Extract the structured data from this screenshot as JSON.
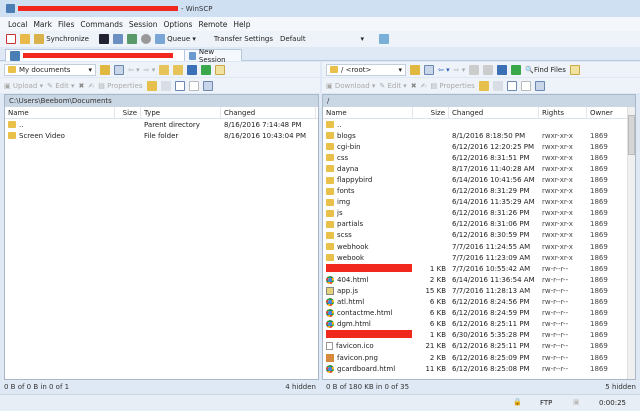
{
  "window": {
    "title_suffix": "- WinSCP"
  },
  "menu": [
    "Local",
    "Mark",
    "Files",
    "Commands",
    "Session",
    "Options",
    "Remote",
    "Help"
  ],
  "toolbar": {
    "synchronize": "Synchronize",
    "queue": "Queue",
    "queue_arrow": "▾",
    "transfer_settings_label": "Transfer Settings",
    "transfer_settings_value": "Default"
  },
  "tabs": {
    "new_session": "New Session"
  },
  "left": {
    "location": "My documents",
    "upload": "Upload",
    "edit": "Edit",
    "properties": "Properties",
    "path": "C:\\Users\\Beebom\\Documents",
    "columns": [
      "Name",
      "Size",
      "Type",
      "Changed"
    ],
    "rows": [
      {
        "name": "..",
        "size": "",
        "type": "Parent directory",
        "changed": "8/16/2016  7:14:48 PM",
        "icon": "parent"
      },
      {
        "name": "Screen Video",
        "size": "",
        "type": "File folder",
        "changed": "8/16/2016  10:43:04 PM",
        "icon": "folder"
      }
    ],
    "status_left": "0 B of 0 B in 0 of 1",
    "status_right": "4 hidden"
  },
  "right": {
    "location": "/ <root>",
    "find_files": "Find Files",
    "download": "Download",
    "edit": "Edit",
    "properties": "Properties",
    "path": "/",
    "columns": [
      "Name",
      "Size",
      "Changed",
      "Rights",
      "Owner"
    ],
    "rows": [
      {
        "name": "..",
        "size": "",
        "changed": "",
        "rights": "",
        "owner": "",
        "icon": "parent"
      },
      {
        "name": "blogs",
        "size": "",
        "changed": "8/1/2016 8:18:50 PM",
        "rights": "rwxr-xr-x",
        "owner": "1869",
        "icon": "folder"
      },
      {
        "name": "cgi-bin",
        "size": "",
        "changed": "6/12/2016 12:20:25 PM",
        "rights": "rwxr-xr-x",
        "owner": "1869",
        "icon": "folder"
      },
      {
        "name": "css",
        "size": "",
        "changed": "6/12/2016 8:31:51 PM",
        "rights": "rwxr-xr-x",
        "owner": "1869",
        "icon": "folder"
      },
      {
        "name": "dayna",
        "size": "",
        "changed": "8/17/2016 11:40:28 AM",
        "rights": "rwxr-xr-x",
        "owner": "1869",
        "icon": "folder"
      },
      {
        "name": "flappybird",
        "size": "",
        "changed": "6/14/2016 10:41:56 AM",
        "rights": "rwxr-xr-x",
        "owner": "1869",
        "icon": "folder"
      },
      {
        "name": "fonts",
        "size": "",
        "changed": "6/12/2016 8:31:29 PM",
        "rights": "rwxr-xr-x",
        "owner": "1869",
        "icon": "folder"
      },
      {
        "name": "img",
        "size": "",
        "changed": "6/14/2016 11:35:29 AM",
        "rights": "rwxr-xr-x",
        "owner": "1869",
        "icon": "folder"
      },
      {
        "name": "js",
        "size": "",
        "changed": "6/12/2016 8:31:26 PM",
        "rights": "rwxr-xr-x",
        "owner": "1869",
        "icon": "folder"
      },
      {
        "name": "partials",
        "size": "",
        "changed": "6/12/2016 8:31:06 PM",
        "rights": "rwxr-xr-x",
        "owner": "1869",
        "icon": "folder"
      },
      {
        "name": "scss",
        "size": "",
        "changed": "6/12/2016 8:30:59 PM",
        "rights": "rwxr-xr-x",
        "owner": "1869",
        "icon": "folder"
      },
      {
        "name": "webhook",
        "size": "",
        "changed": "7/7/2016 11:24:55 AM",
        "rights": "rwxr-xr-x",
        "owner": "1869",
        "icon": "folder"
      },
      {
        "name": "webook",
        "size": "",
        "changed": "7/7/2016 11:23:09 AM",
        "rights": "rwxr-xr-x",
        "owner": "1869",
        "icon": "folder"
      },
      {
        "name": "",
        "size": "1 KB",
        "changed": "7/7/2016 10:55:42 AM",
        "rights": "rw-r--r--",
        "owner": "1869",
        "icon": "redacted"
      },
      {
        "name": "404.html",
        "size": "2 KB",
        "changed": "6/14/2016 11:36:54 AM",
        "rights": "rw-r--r--",
        "owner": "1869",
        "icon": "chrome"
      },
      {
        "name": "app.js",
        "size": "15 KB",
        "changed": "7/7/2016 11:28:13 AM",
        "rights": "rw-r--r--",
        "owner": "1869",
        "icon": "js"
      },
      {
        "name": "atl.html",
        "size": "6 KB",
        "changed": "6/12/2016 8:24:56 PM",
        "rights": "rw-r--r--",
        "owner": "1869",
        "icon": "chrome"
      },
      {
        "name": "contactme.html",
        "size": "6 KB",
        "changed": "6/12/2016 8:24:59 PM",
        "rights": "rw-r--r--",
        "owner": "1869",
        "icon": "chrome"
      },
      {
        "name": "dgm.html",
        "size": "6 KB",
        "changed": "6/12/2016 8:25:11 PM",
        "rights": "rw-r--r--",
        "owner": "1869",
        "icon": "chrome"
      },
      {
        "name": "",
        "size": "1 KB",
        "changed": "6/30/2016 5:35:28 PM",
        "rights": "rw-r--r--",
        "owner": "1869",
        "icon": "redacted"
      },
      {
        "name": "favicon.ico",
        "size": "21 KB",
        "changed": "6/12/2016 8:25:11 PM",
        "rights": "rw-r--r--",
        "owner": "1869",
        "icon": "file"
      },
      {
        "name": "favicon.png",
        "size": "2 KB",
        "changed": "6/12/2016 8:25:09 PM",
        "rights": "rw-r--r--",
        "owner": "1869",
        "icon": "png"
      },
      {
        "name": "gcardboard.html",
        "size": "11 KB",
        "changed": "6/12/2016 8:25:08 PM",
        "rights": "rw-r--r--",
        "owner": "1869",
        "icon": "chrome"
      }
    ],
    "status_left": "0 B of 180 KB in 0 of 35",
    "status_right": "5 hidden"
  },
  "statusbar": {
    "protocol": "FTP",
    "elapsed": "0:00:25"
  },
  "colors": {
    "redaction": "#f0281e",
    "panel_header": "#c9d6e4"
  }
}
